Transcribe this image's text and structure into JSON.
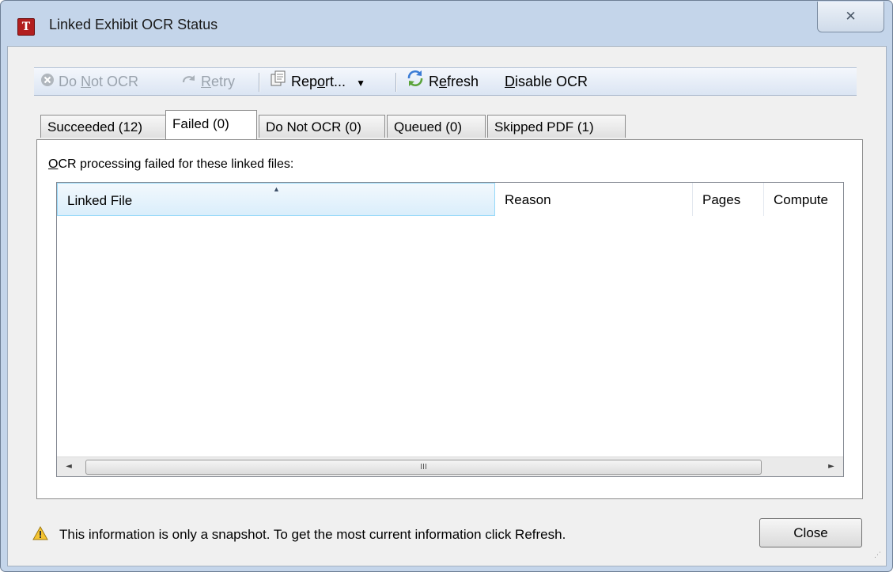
{
  "window": {
    "title": "Linked Exhibit OCR Status",
    "icon_letter": "T",
    "close_glyph": "✕"
  },
  "toolbar": {
    "do_not_ocr": {
      "pre": "Do ",
      "key": "N",
      "post": "ot OCR"
    },
    "retry": {
      "key": "R",
      "post": "etry"
    },
    "report": {
      "pre": "Rep",
      "key": "o",
      "post": "rt..."
    },
    "dropdown_glyph": "▼",
    "refresh": {
      "pre": "R",
      "key": "e",
      "post": "fresh"
    },
    "disable_ocr": {
      "key": "D",
      "post": "isable OCR"
    }
  },
  "tabs": [
    {
      "label": "Succeeded (12)"
    },
    {
      "label": "Failed (0)"
    },
    {
      "label": "Do Not OCR (0)"
    },
    {
      "label": "Queued (0)"
    },
    {
      "label": "Skipped PDF (1)"
    }
  ],
  "panel": {
    "caption_key": "O",
    "caption_rest": "CR processing failed for these linked files:"
  },
  "grid": {
    "columns": [
      "Linked File",
      "Reason",
      "Pages",
      "Compute"
    ],
    "sorted_column": "Linked File",
    "sort_direction": "ascending",
    "rows": []
  },
  "scrollbar": {
    "left_glyph": "◄",
    "right_glyph": "►",
    "thumb_grip": "III"
  },
  "footer": {
    "warning": "This information is only a snapshot.  To get the most current information click Refresh.",
    "close_label": "Close",
    "grip_glyph": "⋰"
  },
  "colors": {
    "accent": "#c4d5ea",
    "app_icon": "#b21e1e",
    "sorted_header": "#daeefb"
  }
}
